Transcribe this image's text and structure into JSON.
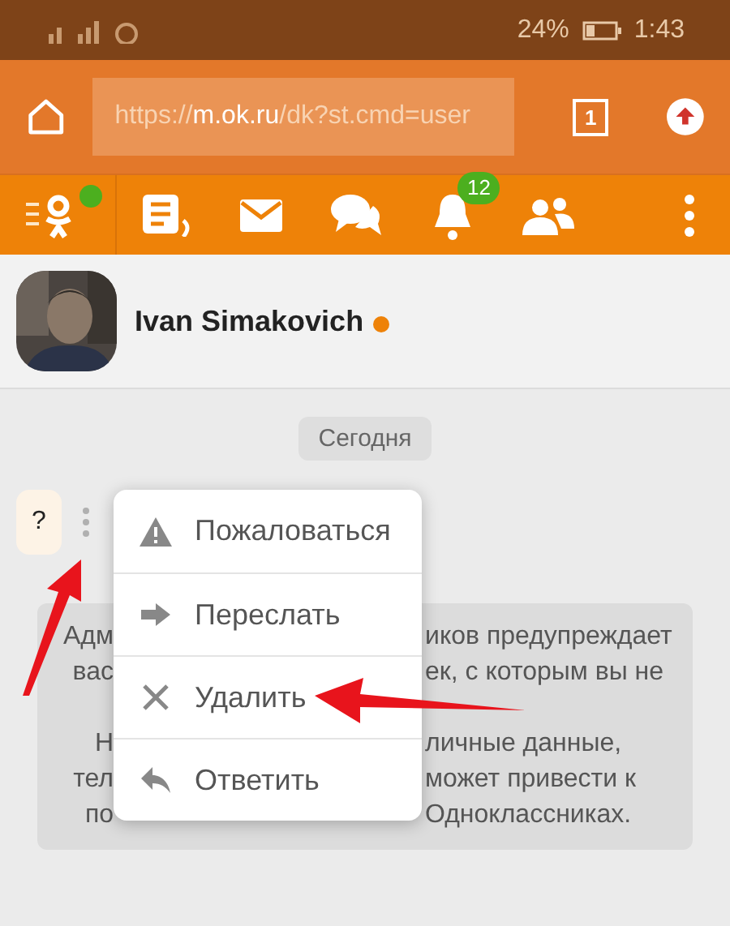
{
  "status_bar": {
    "battery": "24%",
    "time": "1:43"
  },
  "browser": {
    "url": {
      "scheme": "https://",
      "host": "m.ok.ru",
      "path": "/dk?st.cmd=user"
    },
    "tab_count": "1"
  },
  "nav": {
    "notifications_badge": "12",
    "logo_online": true
  },
  "profile": {
    "name": "Ivan Simakovich",
    "online": true
  },
  "chat": {
    "date": "Сегодня",
    "message": "?",
    "notice_paragraphs": [
      [
        {
          "left": "Адм",
          "right": "иков предупреждает"
        },
        {
          "left": "вас",
          "right": "ек, с которым вы не"
        }
      ],
      [
        {
          "left": "Н",
          "right": "личные данные,"
        },
        {
          "left": "тел",
          "right": "может привести к"
        },
        {
          "left": "по",
          "right": "Одноклассниках."
        }
      ]
    ]
  },
  "context_menu": [
    {
      "kind": "report",
      "label": "Пожаловаться"
    },
    {
      "kind": "forward",
      "label": "Переслать"
    },
    {
      "kind": "delete",
      "label": "Удалить"
    },
    {
      "kind": "reply",
      "label": "Ответить"
    }
  ]
}
